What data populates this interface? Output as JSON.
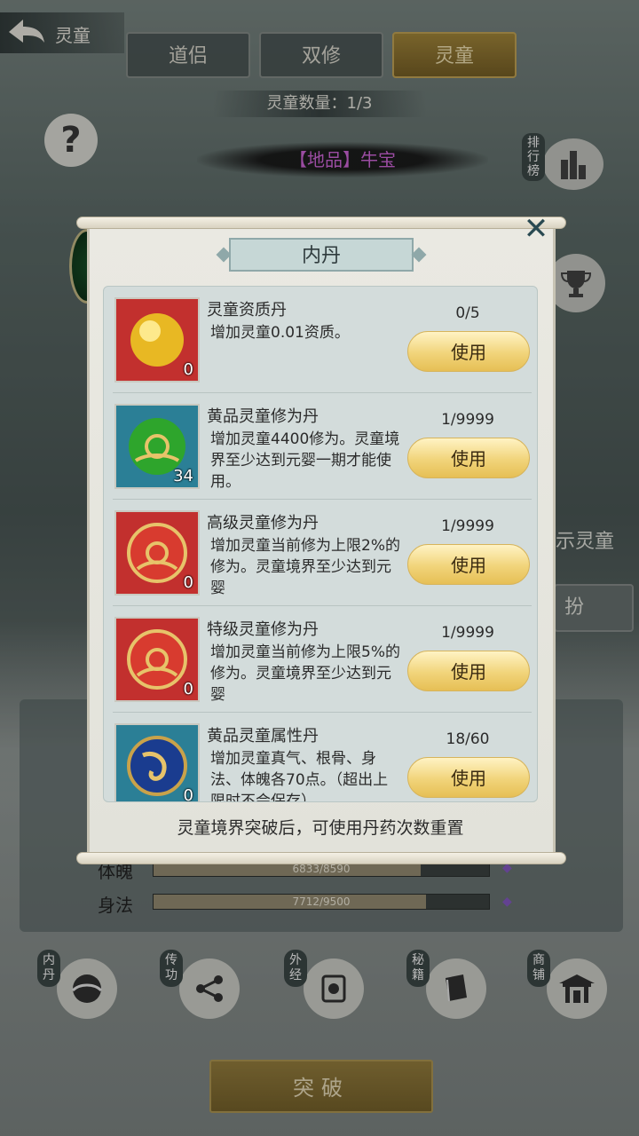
{
  "header": {
    "title": "灵童",
    "tabs": [
      "道侣",
      "双修",
      "灵童"
    ],
    "active_tab": "灵童",
    "count_text": "灵童数量：1/3",
    "pet_name": "【地品】牛宝",
    "rank_label": "排行榜"
  },
  "side": {
    "right_text": "示灵童",
    "right_button": "扮"
  },
  "stats": [
    {
      "label": "体魄",
      "value_text": "6833/8590",
      "fraction": 0.795
    },
    {
      "label": "身法",
      "value_text": "7712/9500",
      "fraction": 0.812
    }
  ],
  "bottom_nav": [
    {
      "label": "内丹",
      "icon": "dan-icon"
    },
    {
      "label": "传功",
      "icon": "share-icon"
    },
    {
      "label": "外经",
      "icon": "scroll-icon"
    },
    {
      "label": "秘籍",
      "icon": "book-icon"
    },
    {
      "label": "商铺",
      "icon": "shop-icon"
    }
  ],
  "breakthrough_label": "突破",
  "modal": {
    "title": "内丹",
    "close_icon": "close-icon",
    "items": [
      {
        "name": "灵童资质丹",
        "desc": "增加灵童0.01资质。",
        "count": "0/5",
        "qty": "0",
        "icon": "gold-pill-icon",
        "bg": "red",
        "button": "使用"
      },
      {
        "name": "黄品灵童修为丹",
        "desc": "增加灵童4400修为。灵童境界至少达到元婴一期才能使用。",
        "count": "1/9999",
        "qty": "34",
        "icon": "green-pill-icon",
        "bg": "teal",
        "button": "使用"
      },
      {
        "name": "高级灵童修为丹",
        "desc": "增加灵童当前修为上限2%的修为。灵童境界至少达到元婴",
        "count": "1/9999",
        "qty": "0",
        "icon": "red-pill-icon",
        "bg": "red",
        "button": "使用"
      },
      {
        "name": "特级灵童修为丹",
        "desc": "增加灵童当前修为上限5%的修为。灵童境界至少达到元婴",
        "count": "1/9999",
        "qty": "0",
        "icon": "red-pill-icon",
        "bg": "red",
        "button": "使用"
      },
      {
        "name": "黄品灵童属性丹",
        "desc": "增加灵童真气、根骨、身法、体魄各70点。（超出上限时不会保存）",
        "count": "18/60",
        "qty": "0",
        "icon": "blue-pill-icon",
        "bg": "teal",
        "button": "使用"
      }
    ],
    "footer": "灵童境界突破后，可使用丹药次数重置"
  }
}
